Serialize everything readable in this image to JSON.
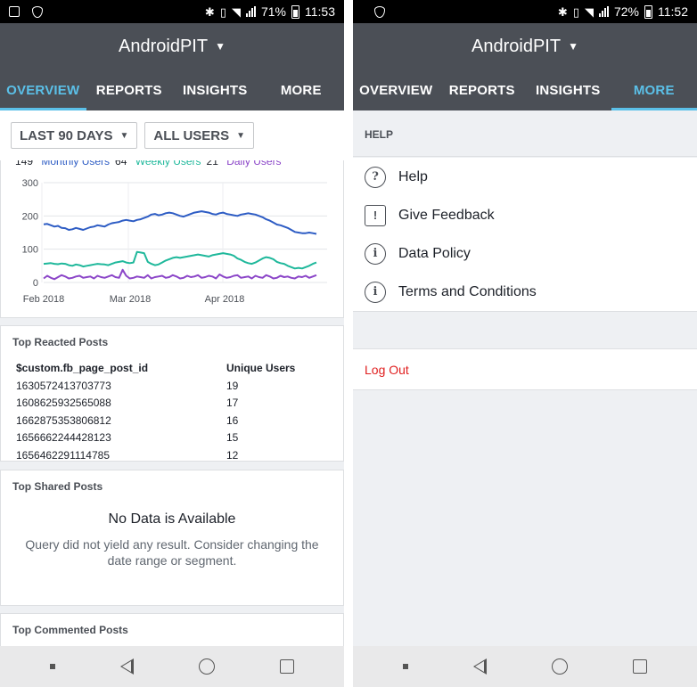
{
  "left": {
    "status": {
      "battery": "71%",
      "time": "11:53"
    },
    "app_title": "AndroidPIT",
    "tabs": [
      "OVERVIEW",
      "REPORTS",
      "INSIGHTS",
      "MORE"
    ],
    "active_tab": "OVERVIEW",
    "filters": {
      "date_range": "LAST 90 DAYS",
      "segment": "ALL USERS"
    },
    "chart_data": {
      "type": "line",
      "legend_partial": [
        {
          "prefix": "149",
          "label": "Monthly Users",
          "color": "#2d5cc4"
        },
        {
          "prefix": "64",
          "label": "Weekly Users",
          "color": "#1fb89b"
        },
        {
          "prefix": "21",
          "label": "Daily Users",
          "color": "#8b45c8"
        }
      ],
      "x_labels": [
        "Feb 2018",
        "Mar 2018",
        "Apr 2018"
      ],
      "y_ticks": [
        0,
        100,
        200,
        300
      ],
      "ylim": [
        0,
        300
      ],
      "grid": true,
      "series": [
        {
          "name": "Monthly Users",
          "color": "#2d5cc4",
          "values": [
            175,
            176,
            172,
            168,
            170,
            164,
            163,
            158,
            160,
            164,
            161,
            158,
            162,
            166,
            168,
            172,
            170,
            168,
            174,
            178,
            180,
            182,
            186,
            188,
            186,
            184,
            188,
            190,
            194,
            198,
            204,
            206,
            202,
            204,
            208,
            210,
            208,
            204,
            200,
            198,
            202,
            206,
            210,
            212,
            214,
            212,
            210,
            206,
            204,
            208,
            210,
            206,
            204,
            202,
            200,
            204,
            206,
            208,
            206,
            204,
            200,
            196,
            190,
            186,
            180,
            174,
            172,
            168,
            164,
            158,
            152,
            150,
            148,
            148,
            150,
            148,
            146
          ]
        },
        {
          "name": "Weekly Users",
          "color": "#1fb89b",
          "values": [
            56,
            57,
            58,
            56,
            55,
            57,
            56,
            52,
            50,
            54,
            52,
            48,
            50,
            52,
            54,
            56,
            55,
            54,
            52,
            56,
            60,
            62,
            64,
            60,
            58,
            60,
            92,
            90,
            88,
            62,
            56,
            52,
            54,
            60,
            66,
            70,
            74,
            76,
            74,
            76,
            78,
            80,
            82,
            84,
            82,
            80,
            78,
            82,
            84,
            86,
            88,
            86,
            84,
            80,
            72,
            68,
            62,
            58,
            56,
            60,
            66,
            72,
            76,
            74,
            70,
            62,
            58,
            56,
            50,
            46,
            42,
            44,
            42,
            46,
            50,
            56,
            60
          ]
        },
        {
          "name": "Daily Users",
          "color": "#8b45c8",
          "values": [
            12,
            20,
            14,
            10,
            16,
            22,
            18,
            12,
            14,
            18,
            20,
            14,
            16,
            18,
            12,
            20,
            16,
            14,
            18,
            22,
            16,
            14,
            38,
            20,
            12,
            14,
            18,
            16,
            14,
            22,
            12,
            16,
            18,
            20,
            14,
            16,
            22,
            18,
            12,
            14,
            20,
            16,
            18,
            22,
            14,
            16,
            20,
            18,
            12,
            24,
            18,
            14,
            16,
            20,
            22,
            14,
            16,
            18,
            12,
            20,
            16,
            14,
            22,
            18,
            12,
            14,
            20,
            16,
            18,
            14,
            12,
            18,
            16,
            20,
            14,
            18,
            22
          ]
        }
      ]
    },
    "reacted": {
      "title": "Top Reacted Posts",
      "columns": [
        "$custom.fb_page_post_id",
        "Unique Users"
      ],
      "rows": [
        [
          "1630572413703773",
          "19"
        ],
        [
          "1608625932565088",
          "17"
        ],
        [
          "1662875353806812",
          "16"
        ],
        [
          "1656662244428123",
          "15"
        ],
        [
          "1656462291114785",
          "12"
        ]
      ]
    },
    "shared": {
      "title": "Top Shared Posts",
      "nodata_title": "No Data is Available",
      "nodata_msg": "Query did not yield any result. Consider changing the date range or segment."
    },
    "commented": {
      "title": "Top Commented Posts"
    }
  },
  "right": {
    "status": {
      "battery": "72%",
      "time": "11:52"
    },
    "app_title": "AndroidPIT",
    "tabs": [
      "OVERVIEW",
      "REPORTS",
      "INSIGHTS",
      "MORE"
    ],
    "active_tab": "MORE",
    "section_header": "HELP",
    "menu": [
      {
        "label": "Help",
        "icon": "?",
        "icon_name": "question-circle-icon",
        "shape": "circle"
      },
      {
        "label": "Give Feedback",
        "icon": "!",
        "icon_name": "feedback-icon",
        "shape": "square"
      },
      {
        "label": "Data Policy",
        "icon": "i",
        "icon_name": "info-circle-icon",
        "shape": "circle"
      },
      {
        "label": "Terms and Conditions",
        "icon": "i",
        "icon_name": "info-circle-icon",
        "shape": "circle"
      }
    ],
    "logout": "Log Out",
    "logout_color": "#e02020"
  }
}
